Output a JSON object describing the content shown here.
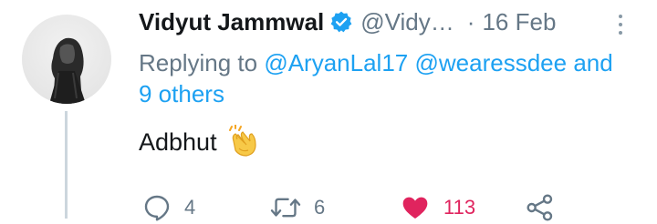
{
  "tweet": {
    "author_name": "Vidyut Jammwal",
    "handle": "@Vidy…",
    "separator": "·",
    "date": "16 Feb",
    "replying_prefix": "Replying to",
    "mention_1": "@AryanLal17",
    "mention_2": "@wearessdee",
    "mention_others": "and 9 others",
    "text": "Adbhut",
    "emoji": "clapping-hands",
    "reply_count": "4",
    "retweet_count": "6",
    "like_count": "113",
    "liked": true
  },
  "colors": {
    "link": "#1da1f2",
    "muted": "#657786",
    "like": "#e0245e",
    "verified": "#1da1f2"
  }
}
